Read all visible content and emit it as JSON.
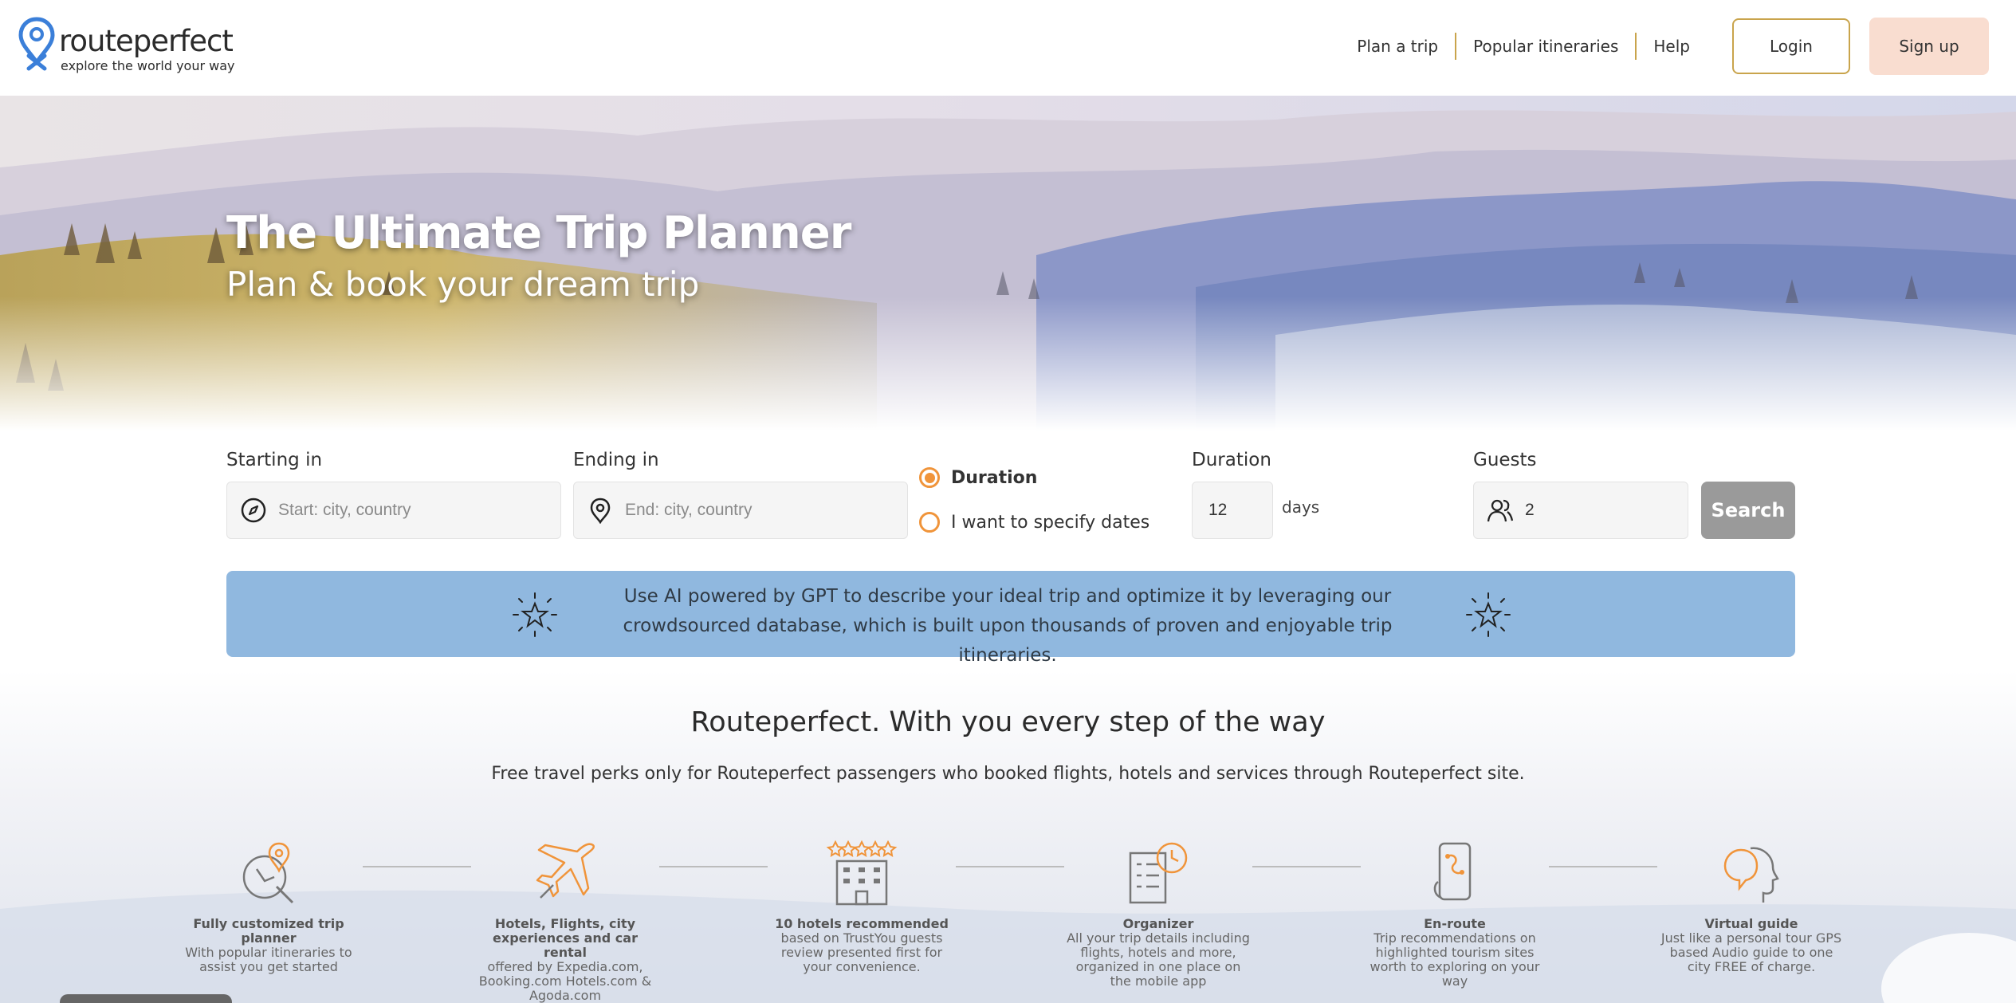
{
  "header": {
    "logo": {
      "name": "routeperfect",
      "tagline": "explore the world your way",
      "icon": "map-pin-icon"
    },
    "nav": {
      "plan_trip": "Plan a trip",
      "popular": "Popular itineraries",
      "help": "Help",
      "login": "Login",
      "signup": "Sign up"
    },
    "accent_color": "#c9a44c"
  },
  "hero": {
    "title": "The Ultimate Trip Planner",
    "subtitle": "Plan & book your dream trip"
  },
  "search": {
    "start": {
      "label": "Starting in",
      "placeholder": "Start: city, country",
      "icon": "compass-icon"
    },
    "end": {
      "label": "Ending in",
      "placeholder": "End: city, country",
      "icon": "location-pin-icon"
    },
    "mode_options": [
      {
        "label": "Duration",
        "selected": true
      },
      {
        "label": "I want to specify dates",
        "selected": false
      }
    ],
    "duration": {
      "label": "Duration",
      "value": "12",
      "unit": "days"
    },
    "guests": {
      "label": "Guests",
      "value": "2",
      "icon": "people-icon"
    },
    "button": "Search",
    "radio_color": "#f0943a"
  },
  "ai_banner": {
    "text": "Use AI powered by GPT to describe your ideal trip and optimize it by leveraging our crowdsourced database, which is built upon thousands of proven and enjoyable trip itineraries.",
    "icon": "sparkle-star-icon",
    "color": "#90b8df"
  },
  "perks": {
    "title": "Routeperfect. With you every step of the way",
    "subtitle": "Free travel perks only for Routeperfect passengers who booked flights, hotels and services through Routeperfect site.",
    "steps": [
      {
        "title": "Fully customized trip planner",
        "desc": "With popular itineraries to assist you get started",
        "icon": "map-planner-icon"
      },
      {
        "title": "Hotels, Flights, city experiences and car rental",
        "desc": "offered by Expedia.com, Booking.com Hotels.com & Agoda.com",
        "icon": "airplane-icon"
      },
      {
        "title": "10 hotels recommended",
        "desc": "based on TrustYou guests review presented first for your convenience.",
        "icon": "hotel-stars-icon"
      },
      {
        "title": "Organizer",
        "desc": "All your trip details including flights, hotels and more, organized in one place on the mobile app",
        "icon": "organizer-checklist-icon"
      },
      {
        "title": "En-route",
        "desc": "Trip recommendations on highlighted tourism sites worth to exploring on your way",
        "icon": "mobile-route-icon"
      },
      {
        "title": "Virtual guide",
        "desc": "Just like a personal tour GPS based Audio guide to one city FREE of charge.",
        "icon": "audio-guide-head-icon"
      }
    ]
  }
}
